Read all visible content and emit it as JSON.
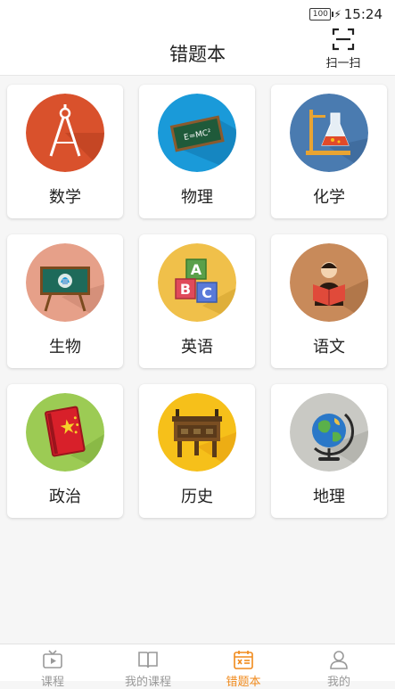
{
  "status_bar": {
    "battery": "100",
    "time": "15:24"
  },
  "header": {
    "title": "错题本",
    "scan_label": "扫一扫"
  },
  "subjects": [
    {
      "label": "数学",
      "icon": "compass-icon",
      "color": "#d9512c"
    },
    {
      "label": "物理",
      "icon": "chalkboard-icon",
      "color": "#1a9ad9"
    },
    {
      "label": "化学",
      "icon": "flask-icon",
      "color": "#4a7bb0"
    },
    {
      "label": "生物",
      "icon": "biology-board-icon",
      "color": "#e6a089"
    },
    {
      "label": "英语",
      "icon": "abc-blocks-icon",
      "color": "#f0c04a"
    },
    {
      "label": "语文",
      "icon": "reading-person-icon",
      "color": "#c88a5a"
    },
    {
      "label": "政治",
      "icon": "red-book-icon",
      "color": "#9ccb54"
    },
    {
      "label": "历史",
      "icon": "bronze-vessel-icon",
      "color": "#f6c01a"
    },
    {
      "label": "地理",
      "icon": "globe-icon",
      "color": "#c9c9c4"
    }
  ],
  "tabs": [
    {
      "label": "课程",
      "icon": "tv-play-icon"
    },
    {
      "label": "我的课程",
      "icon": "book-icon"
    },
    {
      "label": "错题本",
      "icon": "calendar-x-icon",
      "active": true
    },
    {
      "label": "我的",
      "icon": "user-icon"
    }
  ],
  "colors": {
    "active_tab": "#f08a1c",
    "inactive_tab": "#999999"
  }
}
